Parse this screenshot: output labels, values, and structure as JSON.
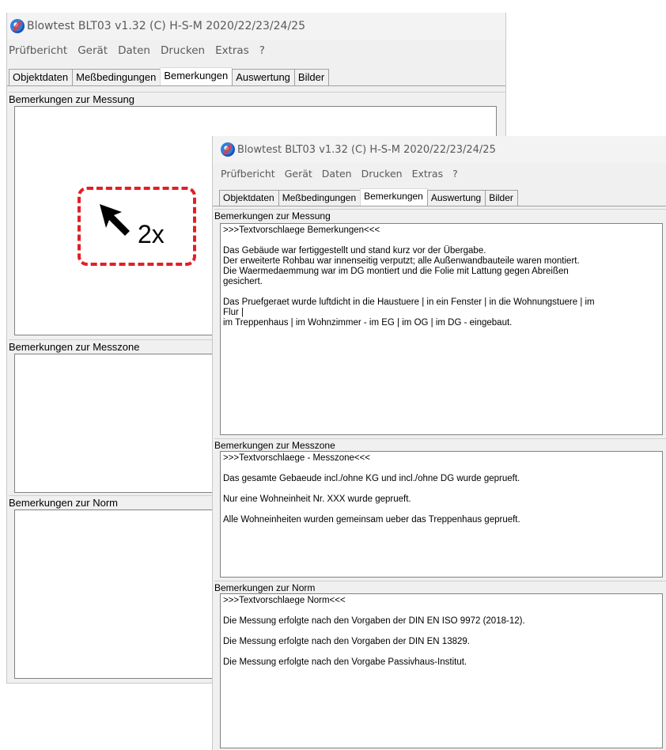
{
  "app": {
    "title": "Blowtest BLT03 v1.32 (C) H-S-M  2020/22/23/24/25",
    "menu": [
      "Prüfbericht",
      "Gerät",
      "Daten",
      "Drucken",
      "Extras",
      "?"
    ],
    "tabs": [
      "Objektdaten",
      "Meßbedingungen",
      "Bemerkungen",
      "Auswertung",
      "Bilder"
    ],
    "active_tab": "Bemerkungen",
    "icon": "fan-app-icon"
  },
  "sections": {
    "messung": "Bemerkungen zur Messung",
    "messzone": "Bemerkungen zur Messzone",
    "norm": "Bemerkungen zur Norm"
  },
  "memos": {
    "messung": [
      ">>>Textvorschlaege Bemerkungen<<<",
      "",
      "Das Gebäude war fertiggestellt und stand kurz vor der Übergabe.",
      "Der erweiterte Rohbau war innenseitig verputzt; alle Außenwandbauteile waren montiert.",
      "Die Waermedaemmung war im DG montiert und die Folie mit Lattung gegen Abreißen",
      "gesichert.",
      "",
      "Das Pruefgeraet wurde luftdicht in die Haustuere | in ein Fenster | in die Wohnungstuere | im",
      "Flur |",
      "im Treppenhaus | im Wohnzimmer - im EG | im OG | im DG - eingebaut."
    ],
    "messzone": [
      ">>>Textvorschlaege - Messzone<<<",
      "",
      "Das gesamte Gebaeude incl./ohne KG und incl./ohne DG wurde geprueft.",
      "",
      "Nur eine Wohneinheit Nr. XXX wurde geprueft.",
      "",
      "Alle Wohneinheiten wurden gemeinsam ueber das Treppenhaus geprueft."
    ],
    "norm": [
      ">>>Textvorschlaege Norm<<<",
      "",
      "Die Messung erfolgte nach den Vorgaben der DIN EN ISO 9972 (2018-12).",
      "",
      "Die Messung erfolgte nach den Vorgaben der DIN EN 13829.",
      "",
      "Die Messung erfolgte nach den Vorgabe Passivhaus-Institut."
    ]
  },
  "annotation": {
    "text": "2x",
    "color": "#e21f26",
    "icon": "cursor-arrow-icon"
  }
}
